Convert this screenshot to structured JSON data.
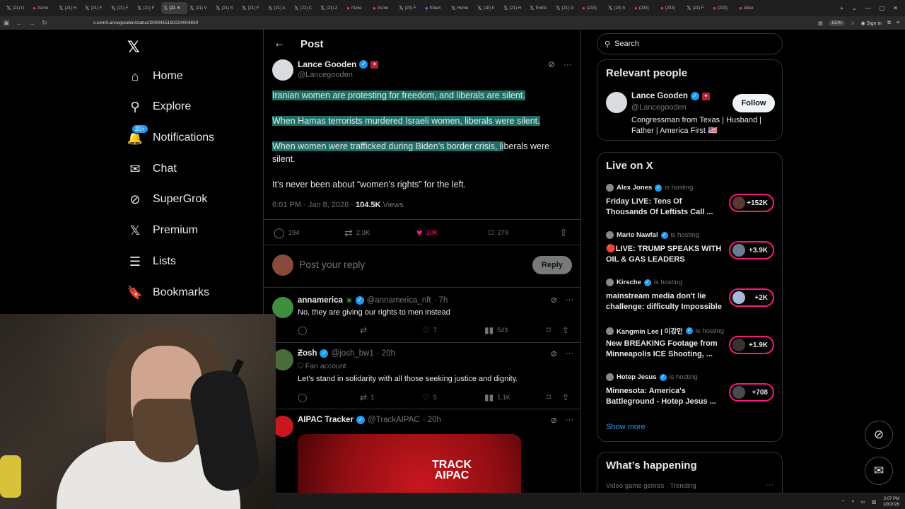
{
  "browser": {
    "tabs": [
      {
        "label": "(21) U",
        "icon": "x-icon"
      },
      {
        "label": "Asmo",
        "icon": "red-circle-icon"
      },
      {
        "label": "(21) H",
        "icon": "x-icon"
      },
      {
        "label": "(21) F",
        "icon": "x-icon"
      },
      {
        "label": "(21) F",
        "icon": "x-icon"
      },
      {
        "label": "(21) F",
        "icon": "x-icon"
      },
      {
        "label": "(21",
        "icon": "x-icon"
      },
      {
        "label": "(21) V",
        "icon": "x-icon"
      },
      {
        "label": "(21) S",
        "icon": "x-icon"
      },
      {
        "label": "(21) F",
        "icon": "x-icon"
      },
      {
        "label": "(21) A",
        "icon": "x-icon"
      },
      {
        "label": "(21) C",
        "icon": "x-icon"
      },
      {
        "label": "(21) Z",
        "icon": "x-icon"
      },
      {
        "label": "r/Live",
        "icon": "red-circle-icon"
      },
      {
        "label": "Asmo",
        "icon": "red-circle-icon"
      },
      {
        "label": "(20) F",
        "icon": "x-icon"
      },
      {
        "label": "Kham",
        "icon": "blue-icon"
      },
      {
        "label": "Home",
        "icon": "x-icon"
      },
      {
        "label": "(18) h",
        "icon": "x-icon"
      },
      {
        "label": "(21) H",
        "icon": "x-icon"
      },
      {
        "label": "Portio",
        "icon": "x-icon"
      },
      {
        "label": "(21) G",
        "icon": "x-icon"
      },
      {
        "label": "(233)",
        "icon": "red-circle-icon"
      },
      {
        "label": "(20) h",
        "icon": "x-icon"
      },
      {
        "label": "(233)",
        "icon": "red-circle-icon"
      },
      {
        "label": "(233)",
        "icon": "red-circle-icon"
      },
      {
        "label": "(21) F",
        "icon": "x-icon"
      },
      {
        "label": "(233)",
        "icon": "red-circle-icon"
      },
      {
        "label": "Abso",
        "icon": "red-circle-icon"
      }
    ],
    "active_tab_index": 6,
    "url": "x.com/Lancegooden/status/2009415160224004830",
    "zoom": "150%",
    "sign_in": "Sign in"
  },
  "nav": {
    "items": [
      {
        "label": "Home",
        "icon": "home-icon",
        "glyph": "⌂"
      },
      {
        "label": "Explore",
        "icon": "search-icon",
        "glyph": "⚲"
      },
      {
        "label": "Notifications",
        "icon": "bell-icon",
        "glyph": "🔔",
        "badge": "20+"
      },
      {
        "label": "Chat",
        "icon": "mail-icon",
        "glyph": "✉"
      },
      {
        "label": "SuperGrok",
        "icon": "grok-icon",
        "glyph": "⊘"
      },
      {
        "label": "Premium",
        "icon": "x-logo-icon",
        "glyph": "𝕏"
      },
      {
        "label": "Lists",
        "icon": "list-icon",
        "glyph": "☰"
      },
      {
        "label": "Bookmarks",
        "icon": "bookmark-icon",
        "glyph": "🔖"
      }
    ]
  },
  "post": {
    "header_title": "Post",
    "author_name": "Lance Gooden",
    "author_handle": "@Lancegooden",
    "line1": "Iranian women are protesting for freedom, and liberals are silent.",
    "line2": "When Hamas terrorists murdered Israeli women, liberals were silent.",
    "line3a": "When women were trafficked during Biden’s border crisis, li",
    "line3b": "berals were",
    "line3c": "silent.",
    "line4": "It’s never been about “women’s rights” for the left.",
    "time": "6:01 PM · Jan 8, 2026 · ",
    "views_count": "104.5K",
    "views_label": " Views",
    "replies": "194",
    "reposts": "2.3K",
    "likes": "10K",
    "bookmarks": "279",
    "reply_placeholder": "Post your reply",
    "reply_button": "Reply"
  },
  "replies": [
    {
      "name": "annamerica",
      "handle": "@annamerica_nft",
      "time": "· 7h",
      "text": "No, they are giving our rights to men instead",
      "sub": "",
      "reply_count": "",
      "repost_count": "",
      "like_count": "7",
      "view_count": "543"
    },
    {
      "name": "Ƶosh",
      "handle": "@josh_bw1",
      "time": "· 20h",
      "sub": "Fan account",
      "text": "Let’s stand in solidarity with all those seeking justice and dignity.",
      "reply_count": "",
      "repost_count": "1",
      "like_count": "5",
      "view_count": "1.1K"
    },
    {
      "name": "AIPAC Tracker",
      "handle": "@TrackAIPAC",
      "time": "· 20h",
      "image_text_1": "TRACK",
      "image_text_2": "AIPAC"
    }
  ],
  "sidebar": {
    "search_placeholder": "Search",
    "relevant_title": "Relevant people",
    "rp_name": "Lance Gooden",
    "rp_handle": "@Lancegooden",
    "rp_bio": "Congressman from Texas | Husband | Father | America First 🇺🇸",
    "follow": "Follow",
    "live_title": "Live on X",
    "live_items": [
      {
        "host": "Alex Jones",
        "hosting": "is hosting",
        "title": "Friday LIVE: Tens Of Thousands Of Leftists Call ...",
        "count": "+152K"
      },
      {
        "host": "Mario Nawfal",
        "hosting": "is hosting",
        "title": "🔴LIVE: TRUMP SPEAKS WITH OIL & GAS LEADERS",
        "count": "+3.9K"
      },
      {
        "host": "Kirsche",
        "hosting": "is hosting",
        "title": "mainstream media don't lie challenge: difficulty Impossible",
        "count": "+2K"
      },
      {
        "host": "Kangmin Lee | 이강민",
        "hosting": "is hosting",
        "title": "New BREAKING Footage from Minneapolis ICE Shooting, ...",
        "count": "+1.9K"
      },
      {
        "host": "Hotep Jesus",
        "hosting": "is hosting",
        "title": "Minnesota: America's Battleground - Hotep Jesus ...",
        "count": "+708"
      }
    ],
    "show_more": "Show more",
    "happening_title": "What’s happening",
    "happening_sub": "Video game genres · Trending"
  },
  "taskbar": {
    "time": "3:07 PM",
    "date": "1/9/2026"
  },
  "colors": {
    "accent": "#1d9bf0",
    "like": "#f91880",
    "highlight": "#1f6f67"
  }
}
